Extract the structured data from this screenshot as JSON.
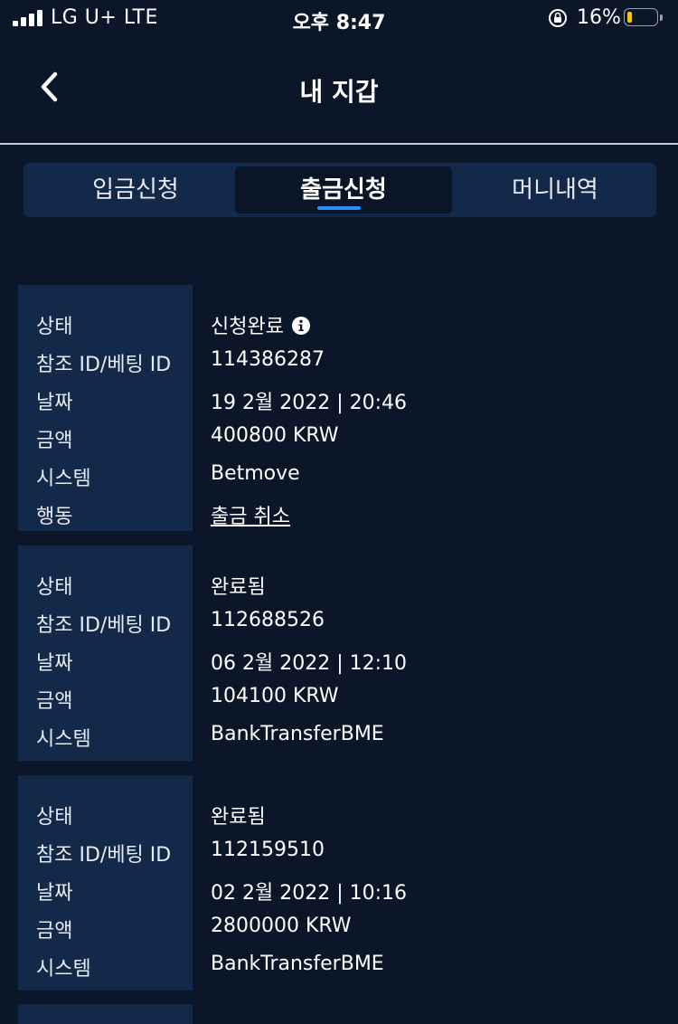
{
  "status_bar": {
    "carrier": "LG U+  LTE",
    "time": "오후 8:47",
    "battery_percent": "16%",
    "battery_level": 0.16
  },
  "header": {
    "title": "내 지갑",
    "back_icon": "chevron-left-icon"
  },
  "tabs": [
    {
      "label": "입금신청",
      "active": false
    },
    {
      "label": "출금신청",
      "active": true
    },
    {
      "label": "머니내역",
      "active": false
    }
  ],
  "cards": [
    {
      "rows": [
        {
          "label": "상태",
          "value": "신청완료",
          "info_icon": true
        },
        {
          "label": "참조 ID/베팅 ID",
          "value": "114386287"
        },
        {
          "label": "날짜",
          "value": "19 2월 2022 | 20:46"
        },
        {
          "label": "금액",
          "value": "400800 KRW"
        },
        {
          "label": "시스템",
          "value": "Betmove"
        },
        {
          "label": "행동",
          "value": "출금 취소",
          "link": true
        }
      ]
    },
    {
      "rows": [
        {
          "label": "상태",
          "value": "완료됨"
        },
        {
          "label": "참조 ID/베팅 ID",
          "value": "112688526"
        },
        {
          "label": "날짜",
          "value": "06 2월 2022 | 12:10"
        },
        {
          "label": "금액",
          "value": "104100 KRW"
        },
        {
          "label": "시스템",
          "value": "BankTransferBME"
        }
      ]
    },
    {
      "rows": [
        {
          "label": "상태",
          "value": "완료됨"
        },
        {
          "label": "참조 ID/베팅 ID",
          "value": "112159510"
        },
        {
          "label": "날짜",
          "value": "02 2월 2022 | 10:16"
        },
        {
          "label": "금액",
          "value": "2800000 KRW"
        },
        {
          "label": "시스템",
          "value": "BankTransferBME"
        }
      ]
    }
  ],
  "colors": {
    "background": "#0b1628",
    "panel": "#13294a",
    "accent": "#2f8cff",
    "danger": "#ff3b3b"
  }
}
